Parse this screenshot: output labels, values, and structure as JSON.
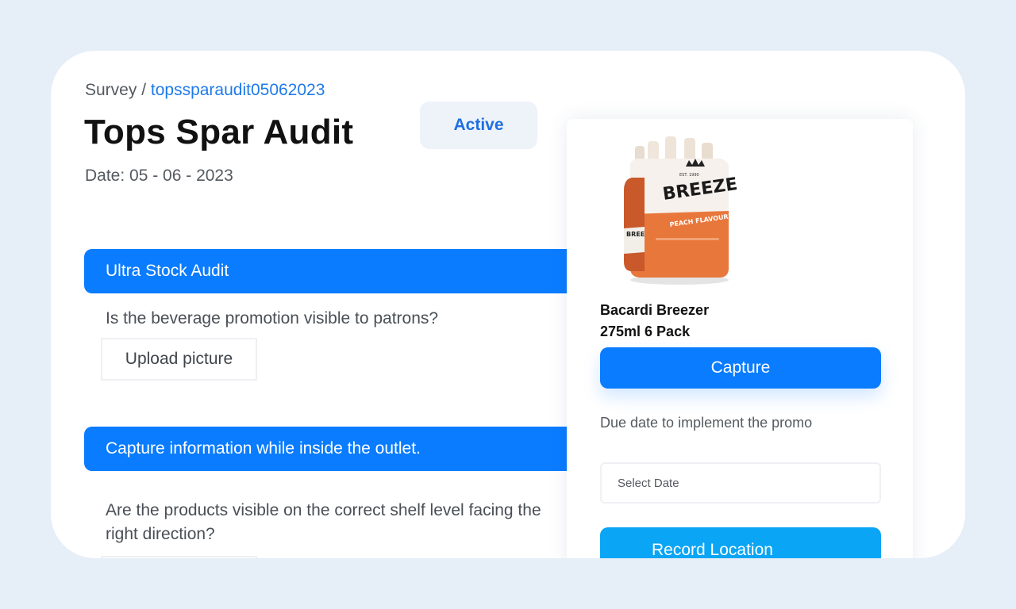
{
  "breadcrumb": {
    "root": "Survey",
    "separator": " / ",
    "current": "topssparaudit05062023"
  },
  "survey": {
    "title": "Tops Spar Audit",
    "status": "Active",
    "date_label": "Date: 05 - 06 - 2023"
  },
  "sections": [
    {
      "title": "Ultra Stock Audit",
      "question": "Is the beverage promotion visible to patrons?",
      "upload_label": "Upload picture"
    },
    {
      "title": "Capture information while inside the outlet.",
      "question": "Are the products visible on the correct shelf level facing the right direction?"
    }
  ],
  "product": {
    "name_line1": "Bacardi Breezer",
    "name_line2": "275ml 6 Pack",
    "image_text": {
      "brand": "BREEZER",
      "est": "EST. 1990",
      "flavour": "PEACH FLAVOURED"
    },
    "capture_label": "Capture",
    "due_label": "Due date to implement the promo",
    "date_placeholder": "Select Date",
    "record_label": "Record Location"
  },
  "colors": {
    "primary": "#0a7cff",
    "record": "#0aa5f5",
    "link": "#1f7ae8",
    "background": "#e6eef8",
    "product_orange": "#e8773c"
  }
}
